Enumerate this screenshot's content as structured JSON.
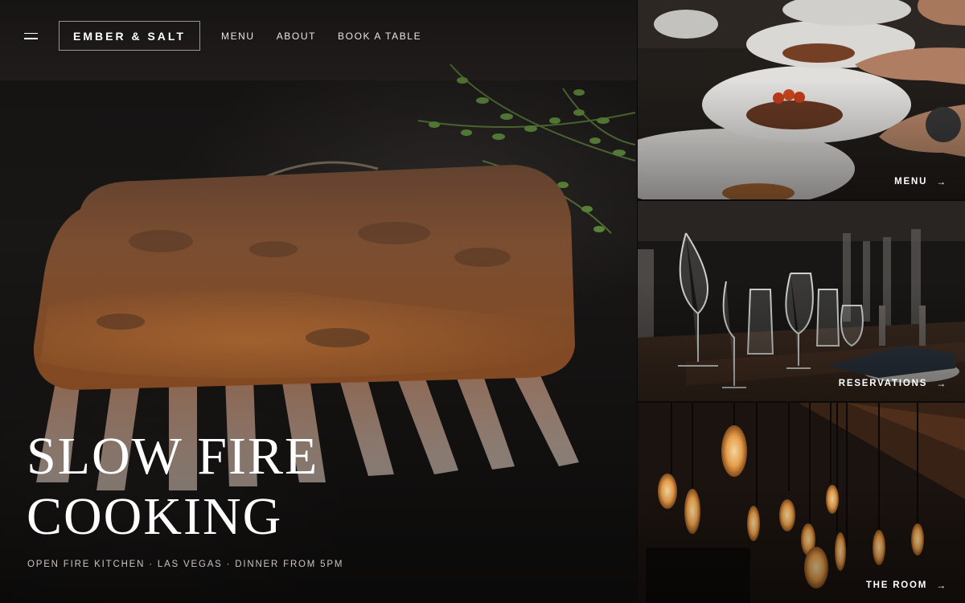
{
  "nav": {
    "menu_icon": "hamburger-icon",
    "brand": "EMBER & SALT",
    "links": [
      "MENU",
      "ABOUT",
      "BOOK A TABLE"
    ]
  },
  "hero": {
    "headline_line1": "SLOW FIRE",
    "headline_line2": "COOKING",
    "tagline": "OPEN FIRE KITCHEN · LAS VEGAS · DINNER FROM 5PM"
  },
  "panels": [
    {
      "label": "MENU",
      "icon": "arrow-right-icon"
    },
    {
      "label": "RESERVATIONS",
      "icon": "arrow-right-icon"
    },
    {
      "label": "THE ROOM",
      "icon": "arrow-right-icon"
    }
  ],
  "colors": {
    "background": "#0d0c0b",
    "text": "#ffffff",
    "meat": "#9a5a32",
    "herb": "#5c7a3a",
    "bulb": "#f3b15c"
  }
}
